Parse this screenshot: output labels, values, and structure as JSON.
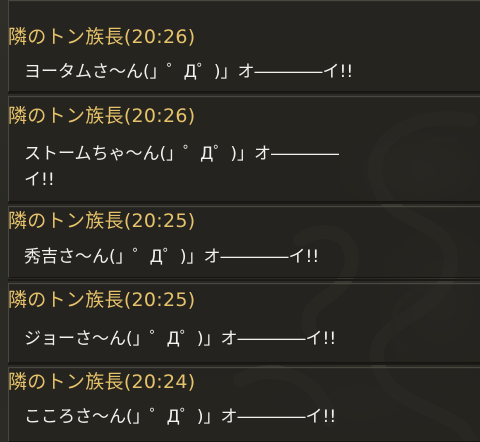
{
  "chat": {
    "messages": [
      {
        "sender": "隣のトン族長",
        "time": "(20:26)",
        "lines": [
          "ヨータムさ～ん(」゜Д゜)」オ――――イ!!"
        ]
      },
      {
        "sender": "隣のトン族長",
        "time": "(20:26)",
        "lines": [
          "ストームちゃ～ん(」゜Д゜)」オ――――",
          "イ!!"
        ]
      },
      {
        "sender": "隣のトン族長",
        "time": "(20:25)",
        "lines": [
          "秀吉さ～ん(」゜Д゜)」オ――――イ!!"
        ]
      },
      {
        "sender": "隣のトン族長",
        "time": "(20:25)",
        "lines": [
          "ジョーさ～ん(」゜Д゜)」オ――――イ!!"
        ]
      },
      {
        "sender": "隣のトン族長",
        "time": "(20:24)",
        "lines": [
          "こころさ～ん(」゜Д゜)」オ――――イ!!"
        ]
      }
    ]
  }
}
